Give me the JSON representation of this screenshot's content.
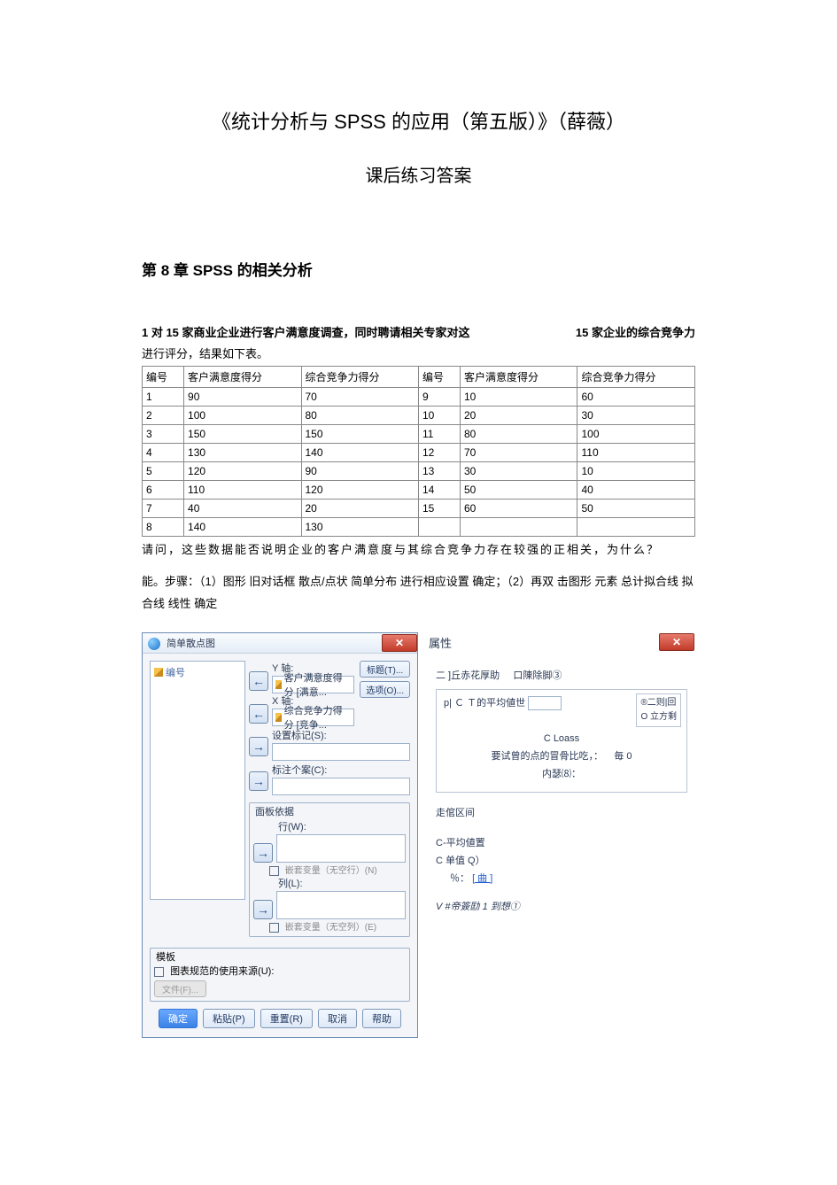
{
  "doc": {
    "title1": "《统计分析与 SPSS 的应用（第五版）》（薛薇）",
    "title2": "课后练习答案",
    "chapter": "第 8 章 SPSS 的相关分析",
    "intro_lead": "1 对 15 家商业企业进行客户满意度调查，同时聘请相关专家对这",
    "intro_right": "15 家企业的综合竞争力",
    "intro_tail": "进行评分，结果如下表。",
    "question": "请问，这些数据能否说明企业的客户满意度与其综合竞争力存在较强的正相关，为什么？",
    "answer": "能。步骤：（1）图形 旧对话框 散点/点状 简单分布 进行相应设置 确定；（2）再双 击图形 元素 总计拟合线 拟合线 线性 确定"
  },
  "table": {
    "headers": [
      "编号",
      "客户满意度得分",
      "综合竞争力得分",
      "编号",
      "客户满意度得分",
      "综合竞争力得分"
    ],
    "rows": [
      [
        "1",
        "90",
        "70",
        "9",
        "10",
        "60"
      ],
      [
        "2",
        "100",
        "80",
        "10",
        "20",
        "30"
      ],
      [
        "3",
        "150",
        "150",
        "11",
        "80",
        "100"
      ],
      [
        "4",
        "130",
        "140",
        "12",
        "70",
        "110"
      ],
      [
        "5",
        "120",
        "90",
        "13",
        "30",
        "10"
      ],
      [
        "6",
        "110",
        "120",
        "14",
        "50",
        "40"
      ],
      [
        "7",
        "40",
        "20",
        "15",
        "60",
        "50"
      ],
      [
        "8",
        "140",
        "130",
        "",
        "",
        ""
      ]
    ]
  },
  "dlg1": {
    "title": "简单散点图",
    "var_item": "编号",
    "y_label": "Y 轴:",
    "y_value": "客户满意度得分 [满意...",
    "x_label": "X 轴:",
    "x_value": "综合竞争力得分 [竞争...",
    "setmark": "设置标记(S):",
    "labelcase": "标注个案(C):",
    "panel_title": "面板依据",
    "row_label": "行(W):",
    "row_chk": "嵌套变量（无空行）(N)",
    "col_label": "列(L):",
    "col_chk": "嵌套变量（无空列）(E)",
    "tmpl_title": "模板",
    "tmpl_chk": "图表规范的使用来源(U):",
    "tmpl_filebtn": "文件(F)...",
    "btn_title": "标题(T)...",
    "btn_options": "选项(O)...",
    "ok": "确定",
    "paste": "粘贴(P)",
    "reset": "重置(R)",
    "cancel": "取消",
    "help": "帮助"
  },
  "dlg2": {
    "title": "属性",
    "tab1": "二 ]丘赤花厚助",
    "tab2": "口陳除脚③",
    "line1": "p| Ｃ Ｔ的平均値世",
    "side1": "®二则|回",
    "side2": "O 立方剩",
    "loass": "C Loass",
    "ratio_label": "要试曾的点的冒骨比吃，：",
    "ratio_value": "毎 0",
    "kernel": "内瑟⑻：",
    "ci_section": "走倌区间",
    "mean": "C-平均値置",
    "single": "C 单值 Q）",
    "percent_label": "％：",
    "percent_link": "[ 曲 ]",
    "footer": "V #帝簽劻 1 到想①"
  }
}
